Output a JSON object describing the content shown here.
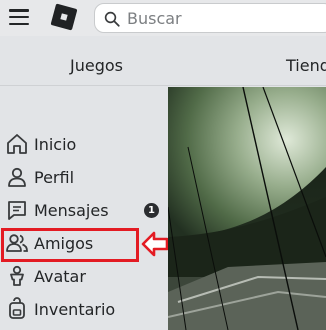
{
  "header": {
    "search_placeholder": "Buscar"
  },
  "tabs": [
    {
      "label": "Juegos"
    },
    {
      "label": "Tiend"
    }
  ],
  "sidebar": {
    "items": [
      {
        "label": "Inicio",
        "icon": "home-icon"
      },
      {
        "label": "Perfil",
        "icon": "user-icon"
      },
      {
        "label": "Mensajes",
        "icon": "messages-icon",
        "badge": "1"
      },
      {
        "label": "Amigos",
        "icon": "friends-icon",
        "highlighted": true
      },
      {
        "label": "Avatar",
        "icon": "avatar-icon"
      },
      {
        "label": "Inventario",
        "icon": "inventory-icon"
      }
    ]
  },
  "colors": {
    "highlight": "#e31b23",
    "header_bg": "#e7e8ea",
    "sidebar_bg": "#e2e4e7"
  }
}
